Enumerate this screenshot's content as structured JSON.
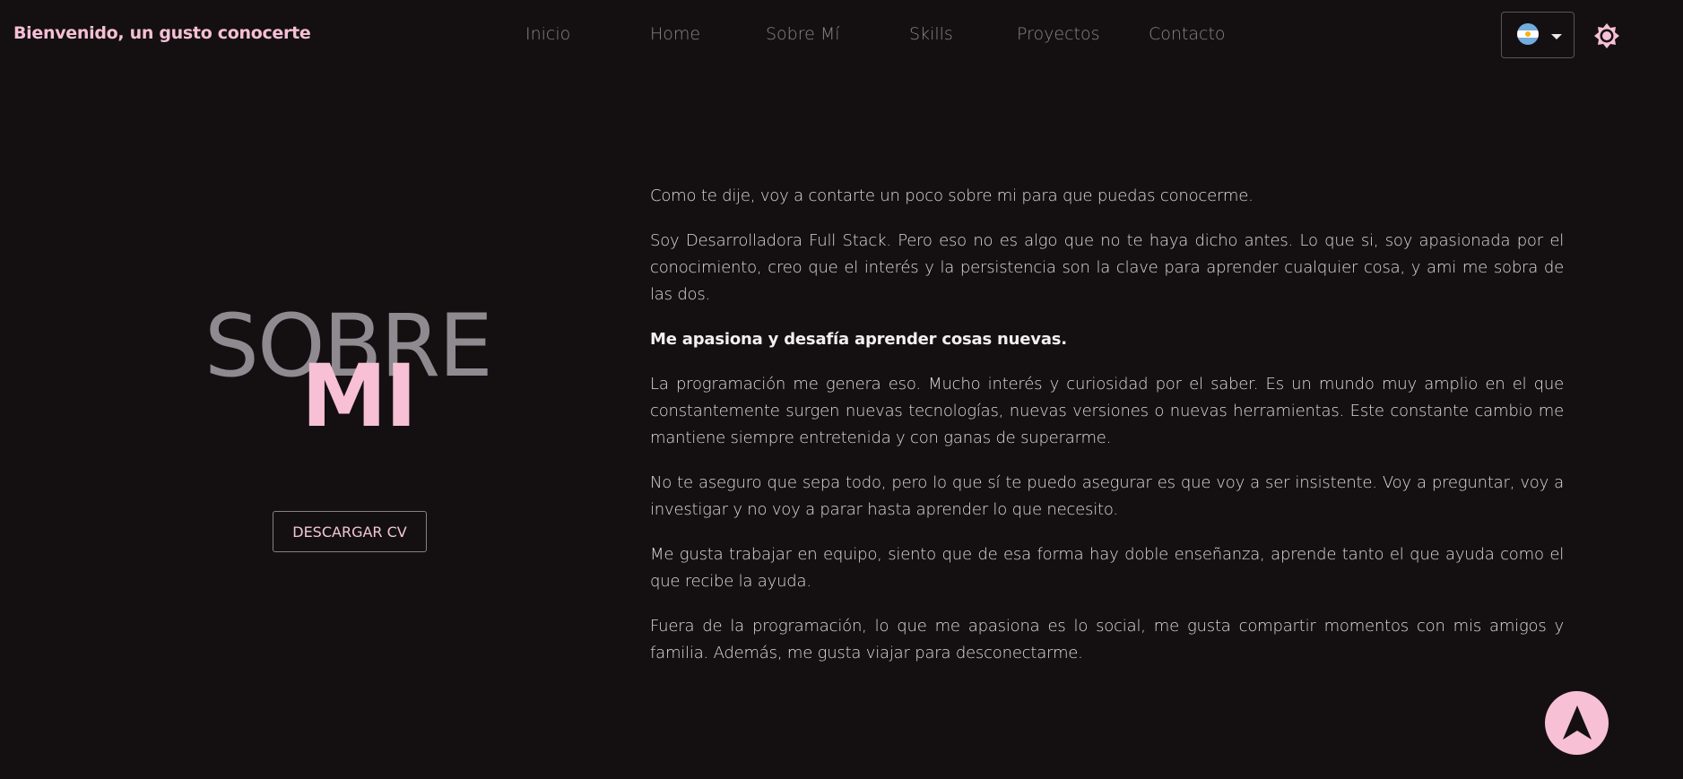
{
  "nav": {
    "brand": "Bienvenido, un gusto conocerte",
    "links": [
      "Inicio",
      "Home",
      "Sobre Mí",
      "Skills",
      "Proyectos",
      "Contacto"
    ],
    "language_flag": "argentina-flag-icon",
    "theme_icon": "sun-icon"
  },
  "hero": {
    "title_top": "SOBRE",
    "title_bottom": "MI",
    "cv_button": "DESCARGAR CV"
  },
  "about": {
    "paragraphs": [
      "Como te dije, voy a contarte un poco sobre mi para que puedas conocerme.",
      "Soy Desarrolladora Full Stack. Pero eso no es algo que no te haya dicho antes. Lo que si, soy apasionada por el conocimiento, creo que el interés y la persistencia son la clave para aprender cualquier cosa, y ami me sobra de las dos.",
      "Me apasiona y desafía aprender cosas nuevas.",
      "La programación me genera eso. Mucho interés y curiosidad por el saber. Es un mundo muy amplio en el que constantemente surgen nuevas tecnologías, nuevas versiones o nuevas herramientas. Este constante cambio me mantiene siempre entretenida y con ganas de superarme.",
      "No te aseguro que sepa todo, pero lo que sí te puedo asegurar es que voy a ser insistente. Voy a preguntar, voy a investigar y no voy a parar hasta aprender lo que necesito.",
      "Me gusta trabajar en equipo, siento que de esa forma hay doble enseñanza, aprende tanto el que ayuda como el que recibe la ayuda.",
      "Fuera de la programación, lo que me apasiona es lo social, me gusta compartir momentos con mis amigos y familia. Además, me gusta viajar para desconectarme."
    ]
  },
  "scroll_top_icon": "arrow-up-icon",
  "colors": {
    "background": "#141012",
    "accent_pink": "#f7c0d5",
    "muted_gray": "#8e8a8f",
    "text": "#e0d6dc"
  }
}
